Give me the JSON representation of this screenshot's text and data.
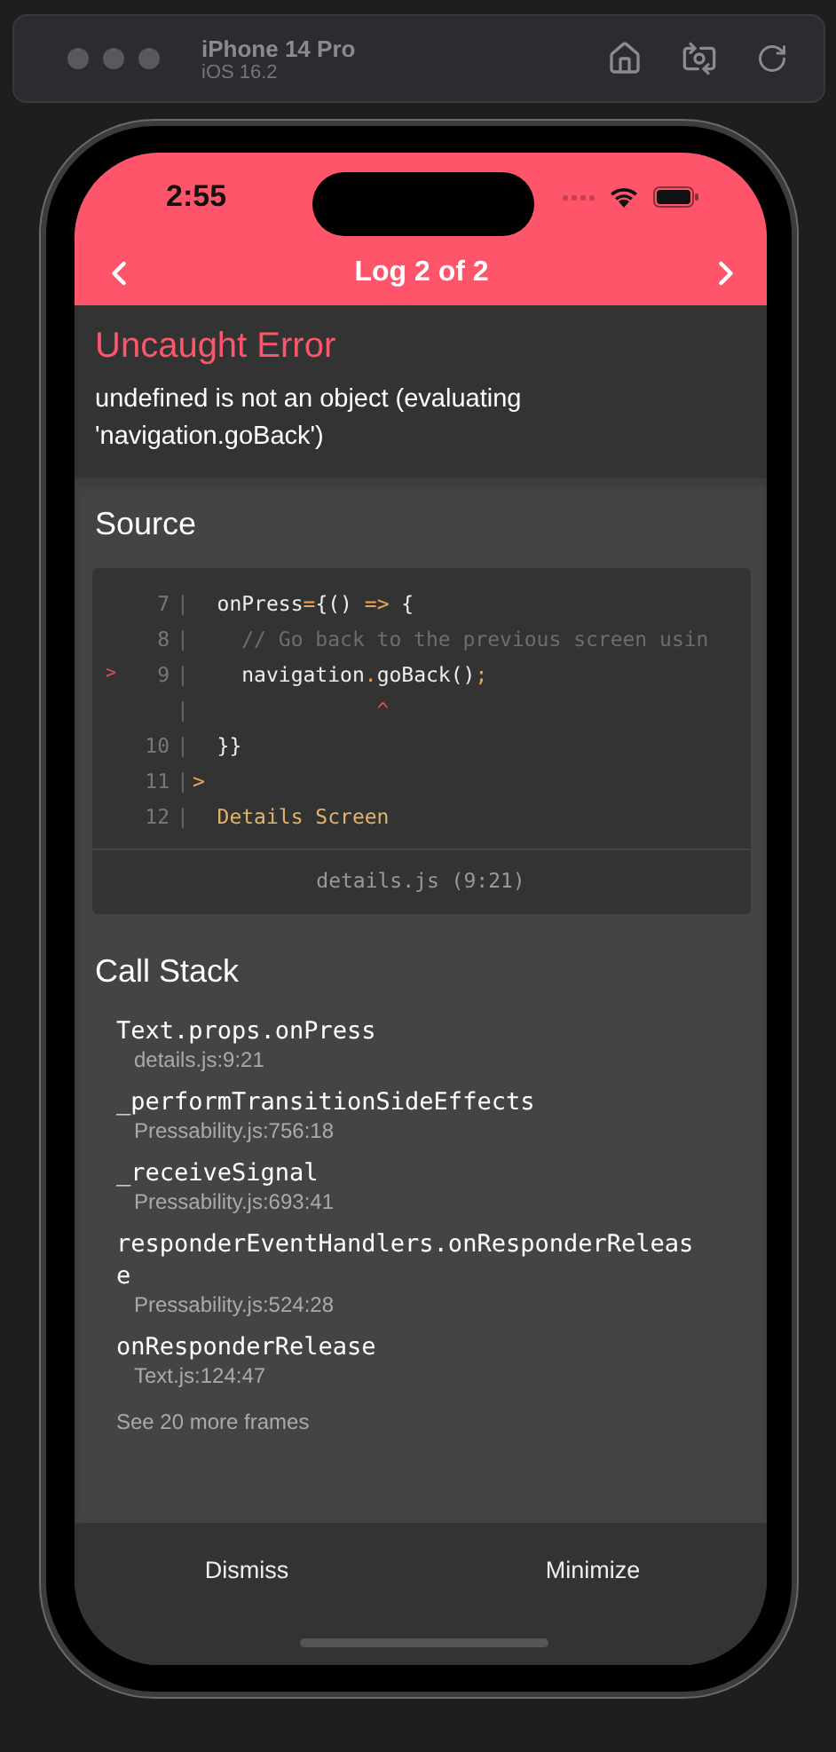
{
  "simulator": {
    "device": "iPhone 14 Pro",
    "os": "iOS 16.2"
  },
  "status_bar": {
    "time": "2:55"
  },
  "nav": {
    "title": "Log 2 of 2"
  },
  "error": {
    "title": "Uncaught Error",
    "message": "undefined is not an object (evaluating 'navigation.goBack')"
  },
  "source": {
    "heading": "Source",
    "file": "details.js (9:21)",
    "lines": [
      {
        "number": "7",
        "gutter": "|",
        "segments": [
          {
            "kind": "plain",
            "text": "  onPress"
          },
          {
            "kind": "op",
            "text": "="
          },
          {
            "kind": "plain",
            "text": "{() "
          },
          {
            "kind": "op",
            "text": "=>"
          },
          {
            "kind": "plain",
            "text": " {"
          }
        ]
      },
      {
        "number": "8",
        "gutter": "|",
        "segments": [
          {
            "kind": "comment",
            "text": "    // Go back to the previous screen usin"
          }
        ]
      },
      {
        "marker": ">",
        "number": "9",
        "gutter": "|",
        "segments": [
          {
            "kind": "plain",
            "text": "    navigation"
          },
          {
            "kind": "op",
            "text": "."
          },
          {
            "kind": "plain",
            "text": "goBack()"
          },
          {
            "kind": "op",
            "text": ";"
          }
        ]
      },
      {
        "gutter": "|",
        "segments": [
          {
            "kind": "error",
            "text": "               ^"
          }
        ]
      },
      {
        "number": "10",
        "gutter": "|",
        "segments": [
          {
            "kind": "plain",
            "text": "  }}"
          }
        ]
      },
      {
        "number": "11",
        "gutter": "|",
        "segments": [
          {
            "kind": "op",
            "text": ">"
          }
        ]
      },
      {
        "number": "12",
        "gutter": "|",
        "segments": [
          {
            "kind": "string",
            "text": "  Details Screen"
          }
        ]
      }
    ]
  },
  "call_stack": {
    "heading": "Call Stack",
    "frames": [
      {
        "name": "Text.props.onPress",
        "location": "details.js:9:21"
      },
      {
        "name": "_performTransitionSideEffects",
        "location": "Pressability.js:756:18"
      },
      {
        "name": "_receiveSignal",
        "location": "Pressability.js:693:41"
      },
      {
        "name": "responderEventHandlers.onResponderRelease",
        "location": "Pressability.js:524:28"
      },
      {
        "name": "onResponderRelease",
        "location": "Text.js:124:47"
      }
    ],
    "more": "See 20 more frames"
  },
  "buttons": [
    "Dismiss",
    "Minimize"
  ]
}
